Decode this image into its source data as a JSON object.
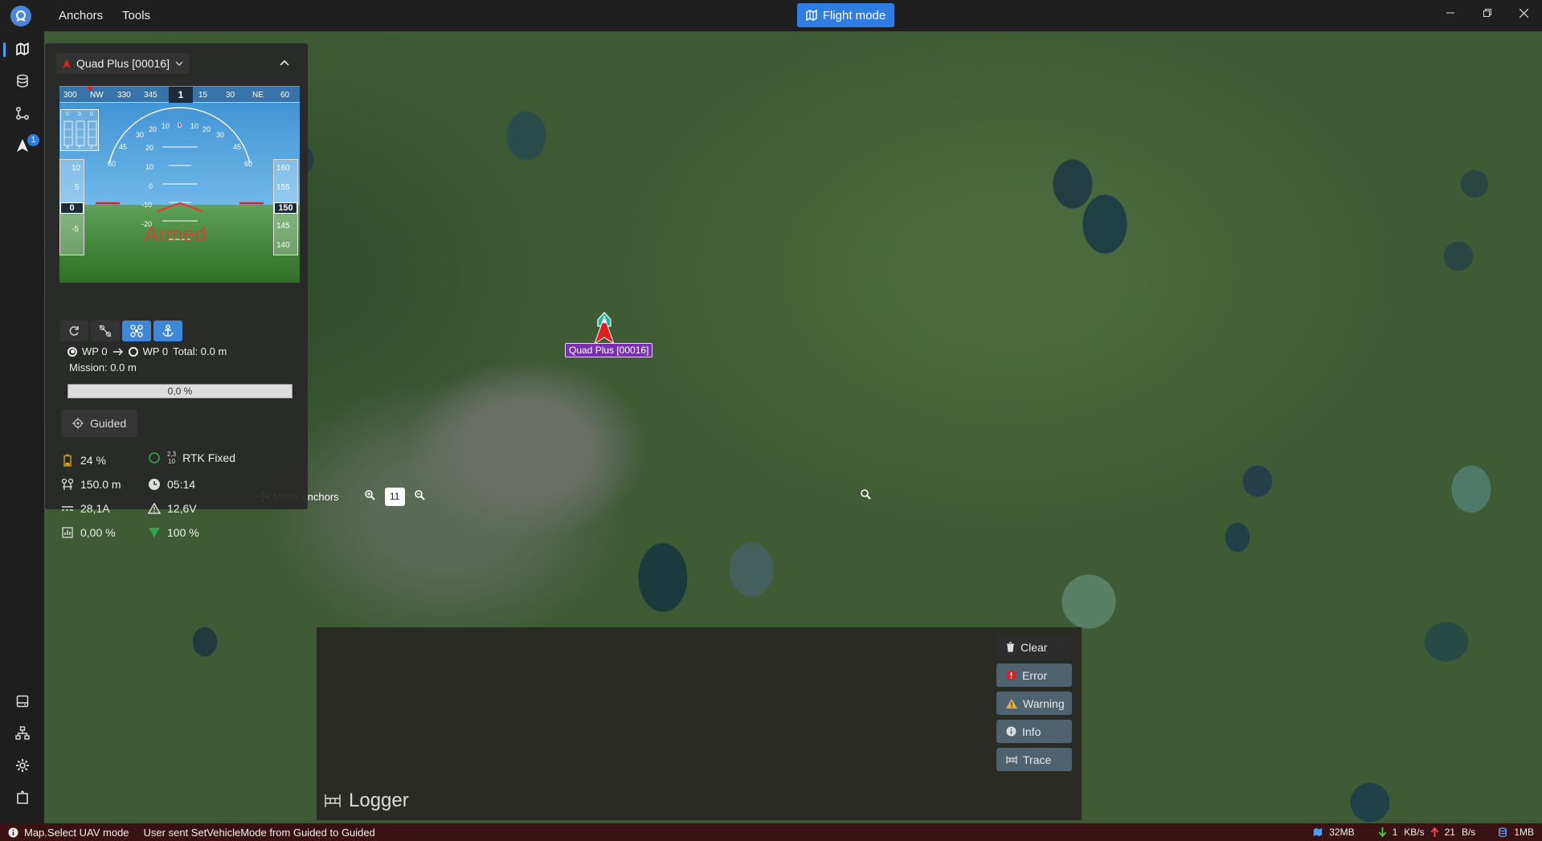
{
  "titlebar": {
    "menu": [
      "Anchors",
      "Tools"
    ],
    "flight_mode_label": "Flight mode"
  },
  "nav": {
    "badge_count": "1"
  },
  "panel": {
    "vehicle_name": "Quad Plus [00016]",
    "compass": {
      "ticks": [
        "300",
        "NW",
        "330",
        "345",
        "15",
        "30",
        "NE",
        "60"
      ],
      "current": "1"
    },
    "speed_tape": [
      "10",
      "5",
      "-5"
    ],
    "speed_current": "0",
    "alt_tape": [
      "160",
      "155",
      "145",
      "140"
    ],
    "alt_current": "150",
    "pitch_labels": [
      "20",
      "10",
      "0",
      "-10",
      "-20"
    ],
    "roll_labels": [
      "60",
      "45",
      "30",
      "20",
      "10",
      "0",
      "10",
      "20",
      "30",
      "45",
      "60"
    ],
    "armed_label": "Armed",
    "indicator_axes": [
      "X",
      "Y",
      "Z"
    ],
    "indicator_vals": [
      "0",
      "0",
      "0"
    ],
    "wp_from": "WP 0",
    "wp_to": "WP 0",
    "wp_total": "Total: 0.0 m",
    "mission": "Mission: 0.0 m",
    "progress_text": "0,0 %",
    "progress_fraction": 0.0,
    "mode": "Guided",
    "battery": "24 %",
    "gps_sats_top": "2,3",
    "gps_sats_bottom": "10",
    "gps_fix": "RTK Fixed",
    "altitude": "150.0 m",
    "flight_time": "05:14",
    "current": "28,1A",
    "voltage": "12,6V",
    "throttle": "0,00 %",
    "link_quality": "100 %"
  },
  "map": {
    "uav_label": "Quad Plus [00016]",
    "move_anchors_label": "Move anchors",
    "zoom_level": "11"
  },
  "logger": {
    "title": "Logger",
    "clear": "Clear",
    "error": "Error",
    "warning": "Warning",
    "info": "Info",
    "trace": "Trace"
  },
  "statusbar": {
    "mode_text": "Map.Select UAV mode",
    "message": "User sent SetVehicleMode from Guided to Guided",
    "memory_map": "32MB",
    "download": "1",
    "download_unit": "KB/s",
    "upload": "21",
    "upload_unit": "B/s",
    "disk": "1MB"
  },
  "colors": {
    "accent": "#2f7de1",
    "statusbar_bg": "#3a1213",
    "uav_marker": "#e02020",
    "uav_label_bg": "#7a2fb0"
  }
}
